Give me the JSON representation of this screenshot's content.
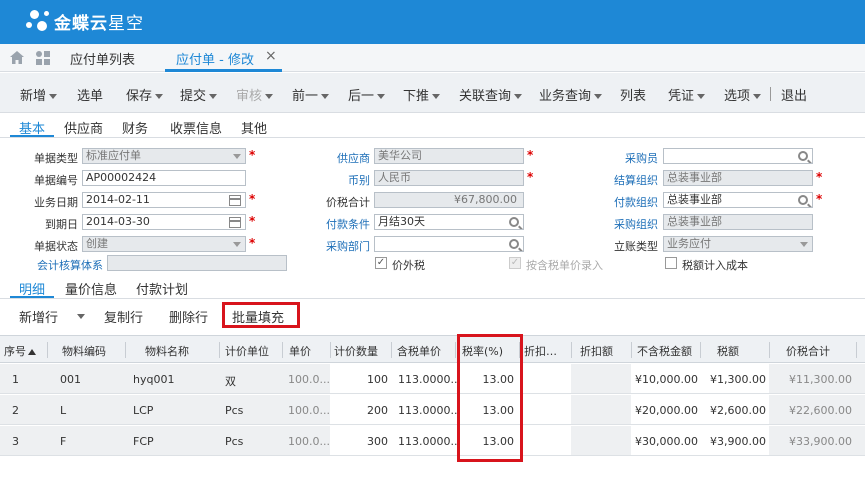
{
  "brand": {
    "name_bold": "金蝶云",
    "name_light": "星空"
  },
  "tabs": [
    {
      "label": "应付单列表"
    },
    {
      "label": "应付单 - 修改"
    }
  ],
  "toolbar": {
    "items": [
      "新增",
      "选单",
      "保存",
      "提交",
      "审核",
      "前一",
      "后一",
      "下推",
      "关联查询",
      "业务查询",
      "列表",
      "凭证",
      "选项",
      "退出"
    ]
  },
  "form_tabs": [
    "基本",
    "供应商",
    "财务",
    "收票信息",
    "其他"
  ],
  "form": {
    "doc_type": {
      "label": "单据类型",
      "value": "标准应付单"
    },
    "doc_no": {
      "label": "单据编号",
      "value": "AP00002424"
    },
    "biz_date": {
      "label": "业务日期",
      "value": "2014-02-11"
    },
    "due_date": {
      "label": "到期日",
      "value": "2014-03-30"
    },
    "doc_status": {
      "label": "单据状态",
      "value": "创建"
    },
    "acct_system": {
      "label": "会计核算体系",
      "value": ""
    },
    "supplier": {
      "label": "供应商",
      "value": "美华公司"
    },
    "currency": {
      "label": "币别",
      "value": "人民币"
    },
    "total_tax": {
      "label": "价税合计",
      "value": "¥67,800.00"
    },
    "pay_terms": {
      "label": "付款条件",
      "value": "月结30天"
    },
    "purchase_dept": {
      "label": "采购部门",
      "value": ""
    },
    "price_excl_tax": {
      "label": "价外税"
    },
    "by_tax_price": {
      "label": "按含税单价录入"
    },
    "buyer": {
      "label": "采购员",
      "value": ""
    },
    "settle_org": {
      "label": "结算组织",
      "value": "总装事业部"
    },
    "pay_org": {
      "label": "付款组织",
      "value": "总装事业部"
    },
    "purchase_org": {
      "label": "采购组织",
      "value": "总装事业部"
    },
    "account_type": {
      "label": "立账类型",
      "value": "业务应付"
    },
    "tax_in_cost": {
      "label": "税额计入成本"
    }
  },
  "detail_tabs": [
    "明细",
    "量价信息",
    "付款计划"
  ],
  "detail_toolbar": {
    "add_row": "新增行",
    "copy_row": "复制行",
    "delete_row": "删除行",
    "batch_fill": "批量填充"
  },
  "grid": {
    "columns": [
      "序号",
      "物料编码",
      "物料名称",
      "计价单位",
      "单价",
      "计价数量",
      "含税单价",
      "税率(%)",
      "折扣…",
      "折扣额",
      "不含税金额",
      "税额",
      "价税合计"
    ],
    "rows": [
      [
        "1",
        "001",
        "hyq001",
        "双",
        "100.0...",
        "100",
        "113.0000...",
        "13.00",
        "",
        "",
        "¥10,000.00",
        "¥1,300.00",
        "¥11,300.00"
      ],
      [
        "2",
        "L",
        "LCP",
        "Pcs",
        "100.0...",
        "200",
        "113.0000...",
        "13.00",
        "",
        "",
        "¥20,000.00",
        "¥2,600.00",
        "¥22,600.00"
      ],
      [
        "3",
        "F",
        "FCP",
        "Pcs",
        "100.0...",
        "300",
        "113.0000...",
        "13.00",
        "",
        "",
        "¥30,000.00",
        "¥3,900.00",
        "¥33,900.00"
      ]
    ]
  },
  "colors": {
    "brand_blue": "#1e88d6",
    "highlight_red": "#d8141c"
  }
}
